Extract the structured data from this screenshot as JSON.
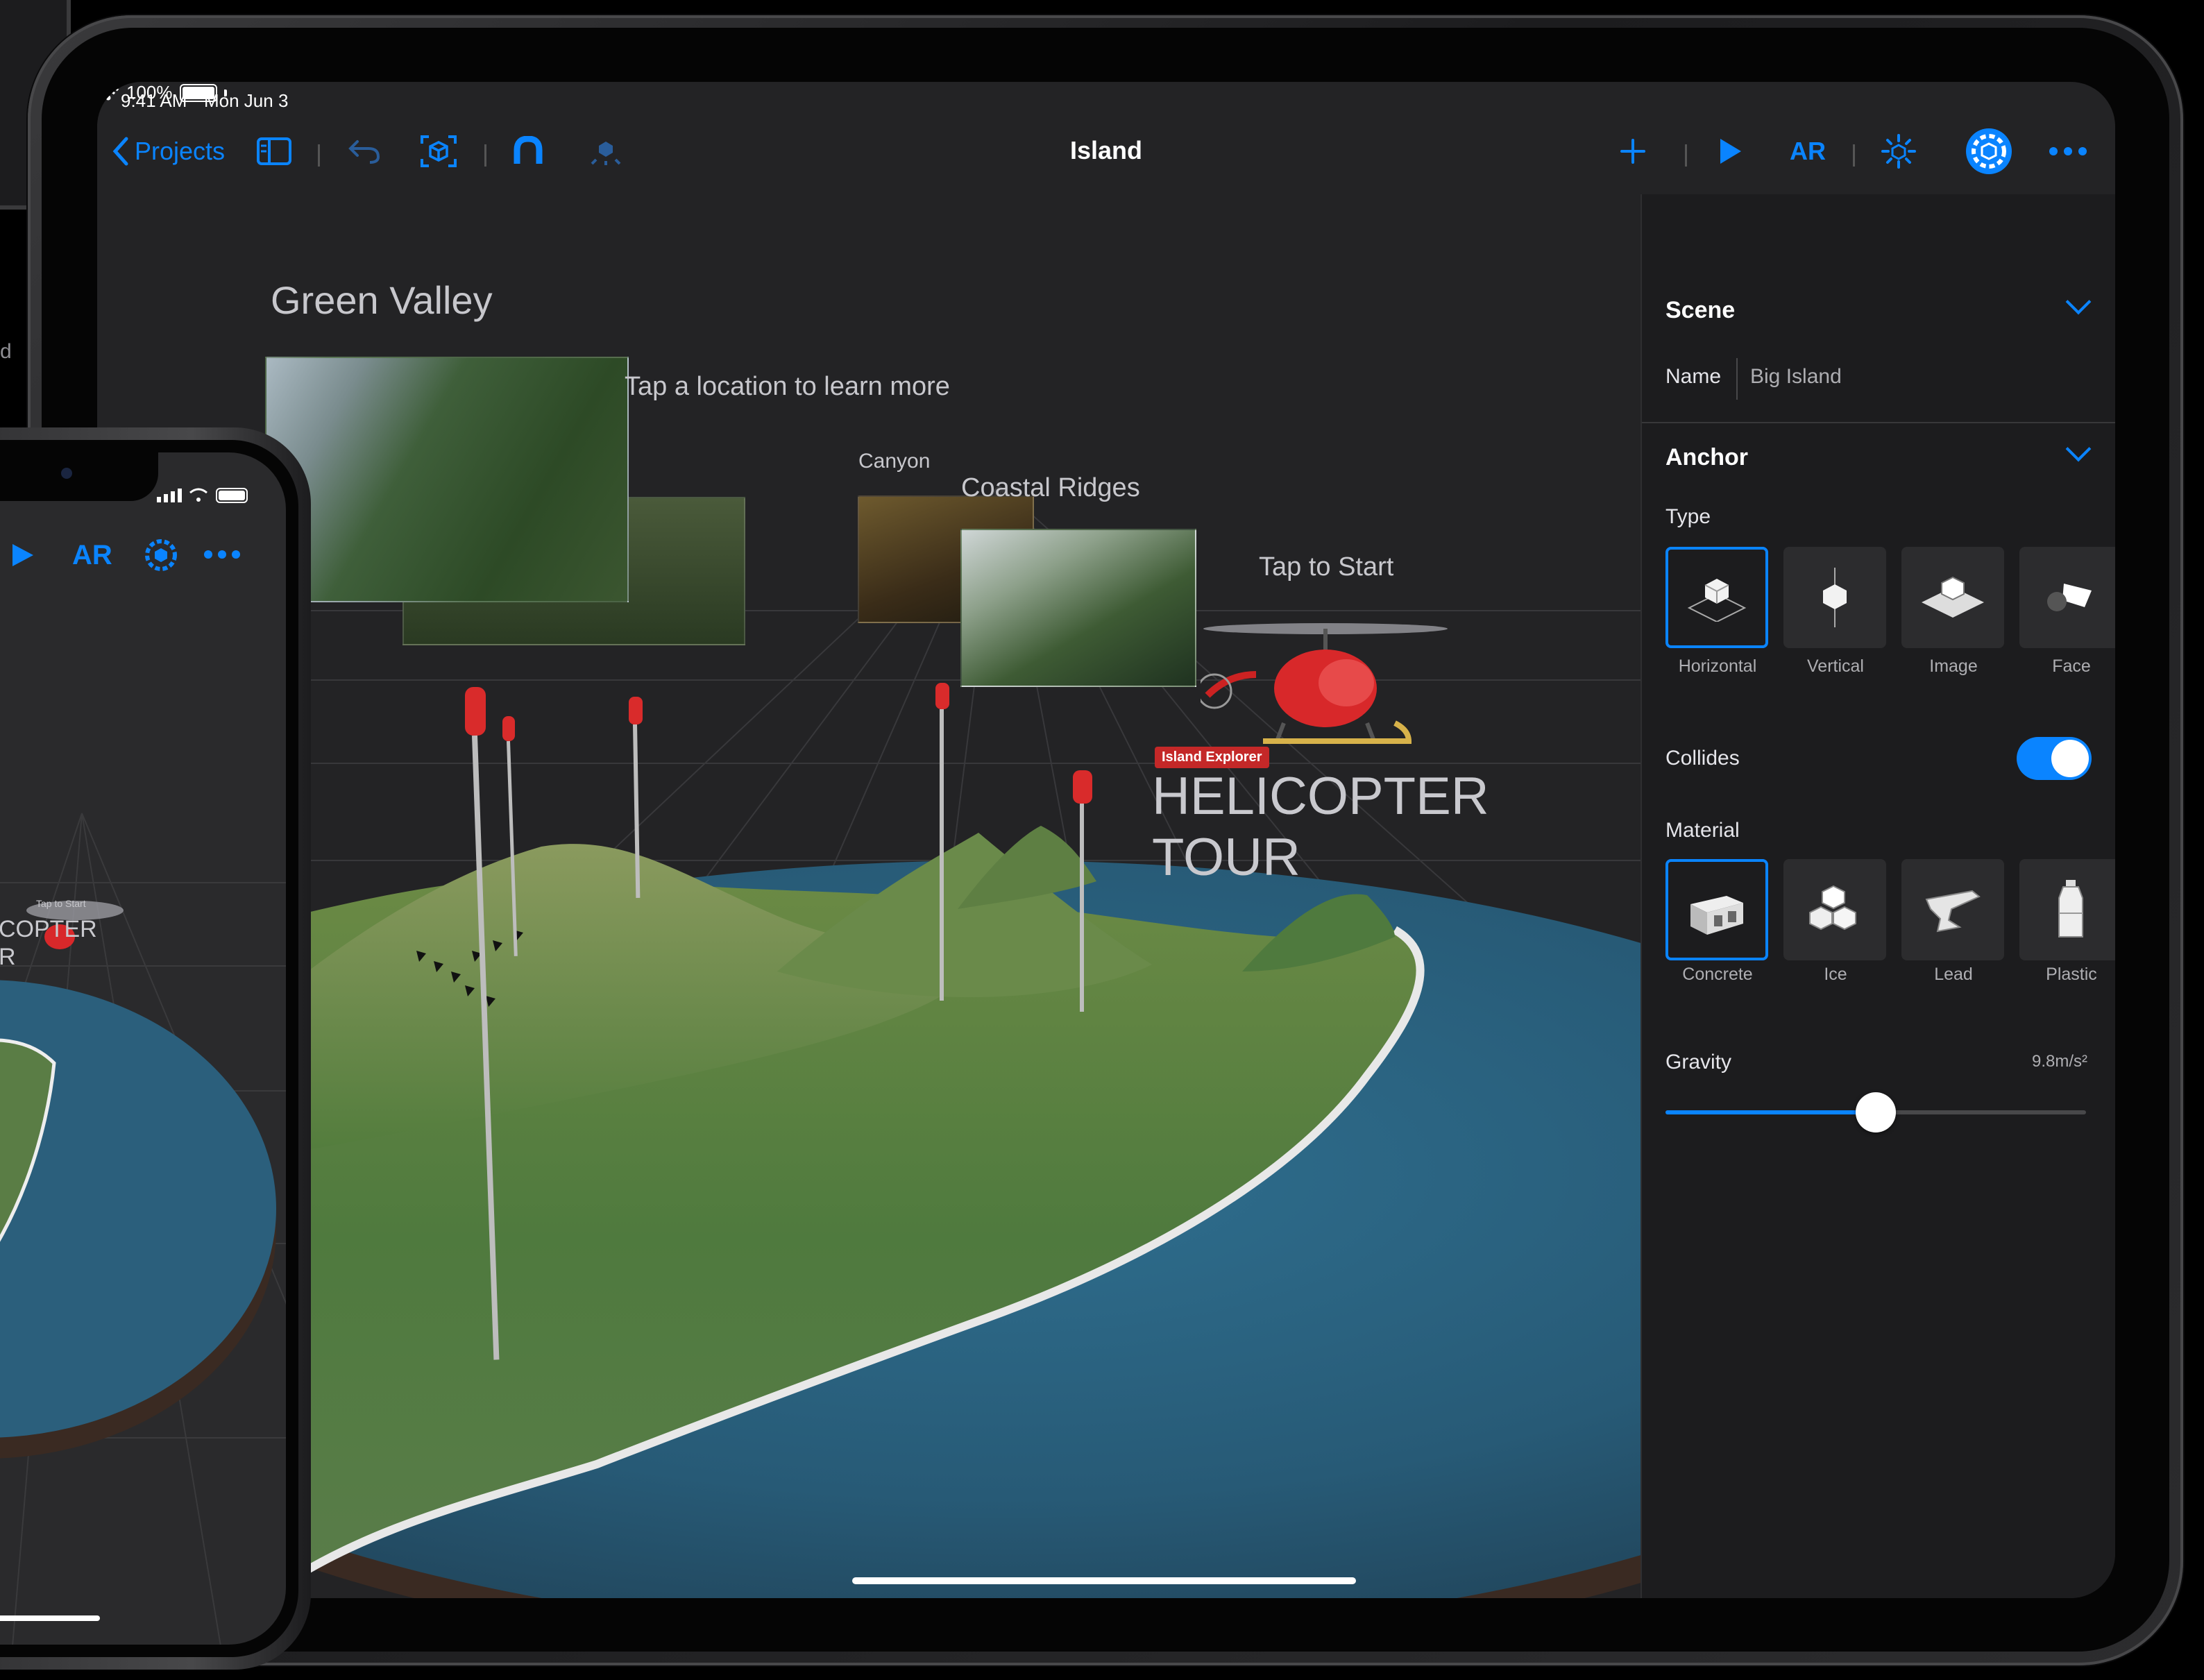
{
  "ipad": {
    "status": {
      "time": "9:41 AM",
      "date": "Mon Jun  3",
      "battery": "100%"
    },
    "nav": {
      "back_label": "Projects",
      "title": "Island",
      "ar_label": "AR"
    },
    "scene_labels": {
      "green_valley": "Green Valley",
      "tap_location": "Tap a location to learn more",
      "canyon": "Canyon",
      "coastal_ridges": "Coastal Ridges",
      "tap_start": "Tap to Start",
      "badge": "Island Explorer",
      "heli_line1": "HELICOPTER",
      "heli_line2": "TOUR"
    },
    "inspector": {
      "scene": {
        "title": "Scene",
        "name_label": "Name",
        "name_value": "Big Island"
      },
      "anchor": {
        "title": "Anchor",
        "type_label": "Type",
        "types": [
          "Horizontal",
          "Vertical",
          "Image",
          "Face"
        ],
        "selected_type": "Horizontal",
        "collides_label": "Collides",
        "collides": true,
        "material_label": "Material",
        "materials": [
          "Concrete",
          "Ice",
          "Lead",
          "Plastic"
        ],
        "selected_material": "Concrete",
        "gravity_label": "Gravity",
        "gravity_value": "9.8m/s²",
        "gravity_slider_fraction": 0.5
      }
    },
    "colors": {
      "accent": "#0a84ff",
      "pin": "#d92b2b",
      "background": "#232325"
    }
  },
  "iphone": {
    "toolbar": {
      "ar_label": "AR"
    },
    "scene_labels": {
      "tap_start": "Tap to Start",
      "heli_partial": "COPTER",
      "heli_partial2": "R"
    }
  }
}
